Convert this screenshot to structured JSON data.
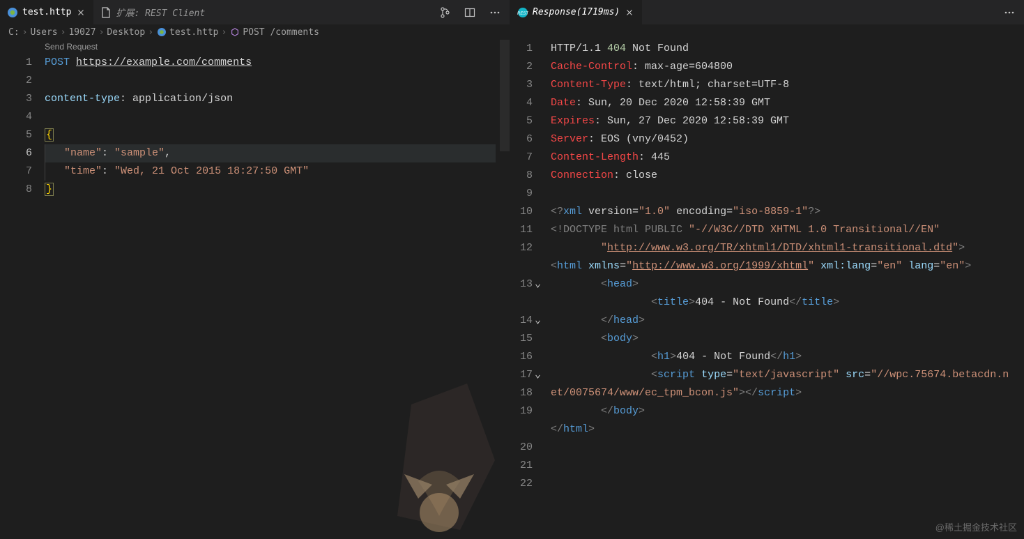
{
  "left": {
    "tabs": [
      {
        "label": "test.http",
        "active": true,
        "icon": "http-file-icon"
      },
      {
        "label": "扩展: REST Client",
        "active": false,
        "icon": "file-icon"
      }
    ],
    "actions": [
      "compare-icon",
      "split-icon",
      "more-icon"
    ],
    "breadcrumb": [
      "C:",
      "Users",
      "19027",
      "Desktop",
      "test.http",
      "POST /comments"
    ],
    "codelens": "Send Request",
    "lines": [
      {
        "n": 1,
        "seg": [
          [
            "kw",
            "POST"
          ],
          [
            "white",
            " "
          ],
          [
            "url",
            "https://example.com/comments"
          ]
        ]
      },
      {
        "n": 2,
        "seg": []
      },
      {
        "n": 3,
        "seg": [
          [
            "attr",
            "content-type"
          ],
          [
            "white",
            ": "
          ],
          [
            "white",
            "application/json"
          ]
        ]
      },
      {
        "n": 4,
        "seg": []
      },
      {
        "n": 5,
        "seg": [
          [
            "bracket",
            "{"
          ]
        ]
      },
      {
        "n": 6,
        "hl": true,
        "indent": 1,
        "seg": [
          [
            "str",
            "\"name\""
          ],
          [
            "white",
            ": "
          ],
          [
            "str",
            "\"sample\""
          ],
          [
            "white",
            ","
          ]
        ]
      },
      {
        "n": 7,
        "indent": 1,
        "seg": [
          [
            "str",
            "\"time\""
          ],
          [
            "white",
            ": "
          ],
          [
            "str",
            "\"Wed, 21 Oct 2015 18:27:50 GMT\""
          ]
        ]
      },
      {
        "n": 8,
        "seg": [
          [
            "bracket",
            "}"
          ]
        ]
      }
    ]
  },
  "right": {
    "tabs": [
      {
        "label": "Response(1719ms)",
        "active": true,
        "icon": "rest-icon"
      }
    ],
    "actions": [
      "more-icon"
    ],
    "lines": [
      {
        "n": 1,
        "seg": [
          [
            "white",
            "HTTP/1.1 "
          ],
          [
            "num",
            "404"
          ],
          [
            "white",
            " Not Found"
          ]
        ]
      },
      {
        "n": 2,
        "seg": [
          [
            "hdr",
            "Cache-Control"
          ],
          [
            "white",
            ": max-age=604800"
          ]
        ]
      },
      {
        "n": 3,
        "seg": [
          [
            "hdr",
            "Content-Type"
          ],
          [
            "white",
            ": text/html; charset=UTF-8"
          ]
        ]
      },
      {
        "n": 4,
        "seg": [
          [
            "hdr",
            "Date"
          ],
          [
            "white",
            ": Sun, 20 Dec 2020 12:58:39 GMT"
          ]
        ]
      },
      {
        "n": 5,
        "seg": [
          [
            "hdr",
            "Expires"
          ],
          [
            "white",
            ": Sun, 27 Dec 2020 12:58:39 GMT"
          ]
        ]
      },
      {
        "n": 6,
        "seg": [
          [
            "hdr",
            "Server"
          ],
          [
            "white",
            ": EOS (vny/0452)"
          ]
        ]
      },
      {
        "n": 7,
        "seg": [
          [
            "hdr",
            "Content-Length"
          ],
          [
            "white",
            ": 445"
          ]
        ]
      },
      {
        "n": 8,
        "seg": [
          [
            "hdr",
            "Connection"
          ],
          [
            "white",
            ": close"
          ]
        ]
      },
      {
        "n": 9,
        "seg": []
      },
      {
        "n": 10,
        "seg": [
          [
            "pi",
            "<?"
          ],
          [
            "tag",
            "xml"
          ],
          [
            "white",
            " version="
          ],
          [
            "str",
            "\"1.0\""
          ],
          [
            "white",
            " encoding="
          ],
          [
            "str",
            "\"iso-8859-1\""
          ],
          [
            "pi",
            "?>"
          ]
        ]
      },
      {
        "n": 11,
        "seg": [
          [
            "doctype",
            "<!DOCTYPE html PUBLIC "
          ],
          [
            "str",
            "\"-//W3C//DTD XHTML 1.0 Transitional//EN\""
          ]
        ]
      },
      {
        "n": 12,
        "seg": [
          [
            "white",
            "        "
          ],
          [
            "str",
            "\""
          ],
          [
            "link",
            "http://www.w3.org/TR/xhtml1/DTD/xhtml1-transitional.dtd"
          ],
          [
            "str",
            "\""
          ],
          [
            "doctype",
            ">"
          ]
        ]
      },
      {
        "n": 13,
        "fold": true,
        "seg": [
          [
            "pi",
            "<"
          ],
          [
            "tag",
            "html"
          ],
          [
            "white",
            " "
          ],
          [
            "attrn",
            "xmlns"
          ],
          [
            "white",
            "="
          ],
          [
            "str",
            "\""
          ],
          [
            "link",
            "http://www.w3.org/1999/xhtml"
          ],
          [
            "str",
            "\""
          ],
          [
            "white",
            " "
          ],
          [
            "attrn",
            "xml:lang"
          ],
          [
            "white",
            "="
          ],
          [
            "str",
            "\"en\""
          ],
          [
            "white",
            " "
          ],
          [
            "attrn",
            "lang"
          ],
          [
            "white",
            "="
          ],
          [
            "str",
            "\"en\""
          ],
          [
            "pi",
            ">"
          ]
        ]
      },
      {
        "n": 14,
        "fold": true,
        "seg": [
          [
            "white",
            "        "
          ],
          [
            "pi",
            "<"
          ],
          [
            "tag",
            "head"
          ],
          [
            "pi",
            ">"
          ]
        ]
      },
      {
        "n": 15,
        "seg": [
          [
            "white",
            "                "
          ],
          [
            "pi",
            "<"
          ],
          [
            "tag",
            "title"
          ],
          [
            "pi",
            ">"
          ],
          [
            "white",
            "404 - Not Found"
          ],
          [
            "pi",
            "</"
          ],
          [
            "tag",
            "title"
          ],
          [
            "pi",
            ">"
          ]
        ]
      },
      {
        "n": 16,
        "seg": [
          [
            "white",
            "        "
          ],
          [
            "pi",
            "</"
          ],
          [
            "tag",
            "head"
          ],
          [
            "pi",
            ">"
          ]
        ]
      },
      {
        "n": 17,
        "fold": true,
        "seg": [
          [
            "white",
            "        "
          ],
          [
            "pi",
            "<"
          ],
          [
            "tag",
            "body"
          ],
          [
            "pi",
            ">"
          ]
        ]
      },
      {
        "n": 18,
        "seg": [
          [
            "white",
            "                "
          ],
          [
            "pi",
            "<"
          ],
          [
            "tag",
            "h1"
          ],
          [
            "pi",
            ">"
          ],
          [
            "white",
            "404 - Not Found"
          ],
          [
            "pi",
            "</"
          ],
          [
            "tag",
            "h1"
          ],
          [
            "pi",
            ">"
          ]
        ]
      },
      {
        "n": 19,
        "seg": [
          [
            "white",
            "                "
          ],
          [
            "pi",
            "<"
          ],
          [
            "tag",
            "script"
          ],
          [
            "white",
            " "
          ],
          [
            "attrn",
            "type"
          ],
          [
            "white",
            "="
          ],
          [
            "str",
            "\"text/javascript\""
          ],
          [
            "white",
            " "
          ],
          [
            "attrn",
            "src"
          ],
          [
            "white",
            "="
          ],
          [
            "str",
            "\"//wpc.75674.betacdn.net/0075674/www/ec_tpm_bcon.js\""
          ],
          [
            "pi",
            "></"
          ],
          [
            "tag",
            "script"
          ],
          [
            "pi",
            ">"
          ]
        ]
      },
      {
        "n": 20,
        "seg": [
          [
            "white",
            "        "
          ],
          [
            "pi",
            "</"
          ],
          [
            "tag",
            "body"
          ],
          [
            "pi",
            ">"
          ]
        ]
      },
      {
        "n": 21,
        "seg": [
          [
            "pi",
            "</"
          ],
          [
            "tag",
            "html"
          ],
          [
            "pi",
            ">"
          ]
        ]
      },
      {
        "n": 22,
        "seg": []
      }
    ]
  },
  "watermark": "@稀土掘金技术社区"
}
